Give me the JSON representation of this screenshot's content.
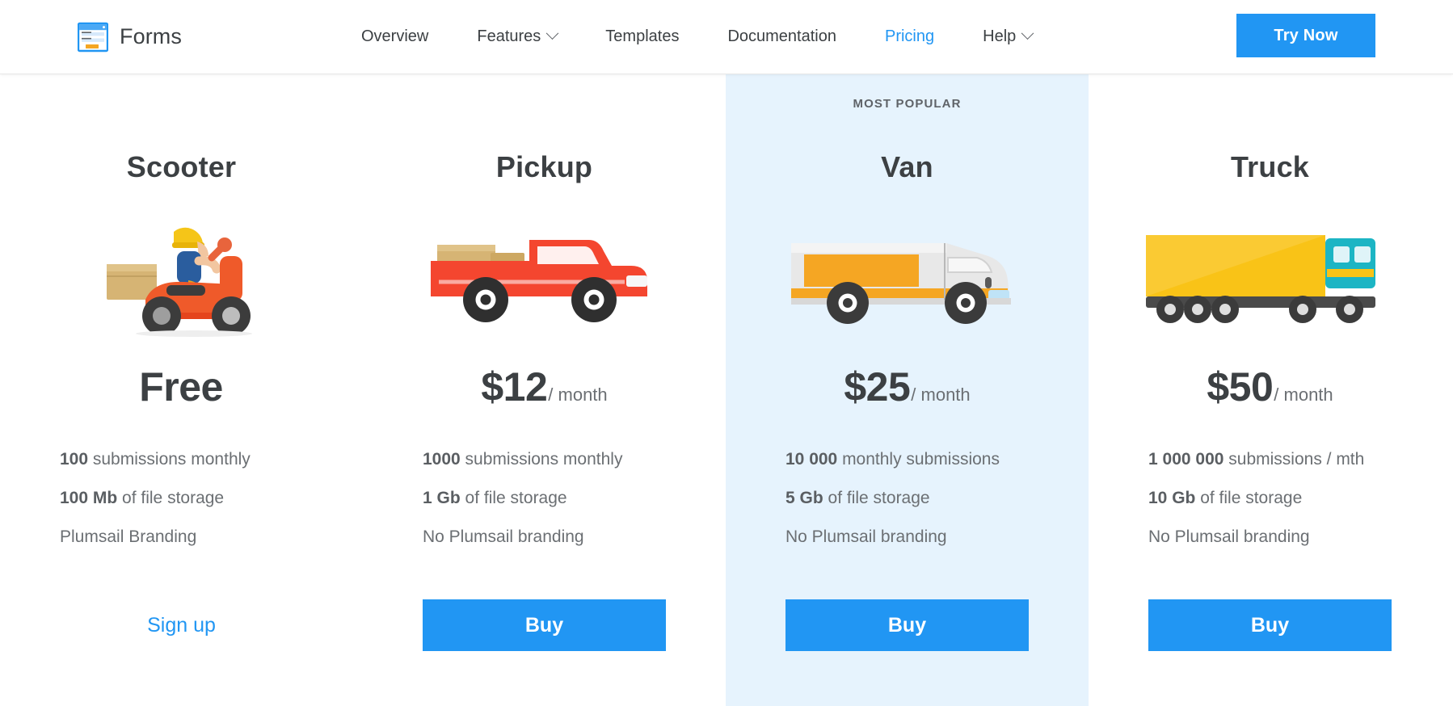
{
  "header": {
    "brand": {
      "icon": "forms-logo-icon",
      "name": "Forms"
    },
    "nav": [
      {
        "label": "Overview",
        "has_dropdown": false,
        "active": false
      },
      {
        "label": "Features",
        "has_dropdown": true,
        "active": false
      },
      {
        "label": "Templates",
        "has_dropdown": false,
        "active": false
      },
      {
        "label": "Documentation",
        "has_dropdown": false,
        "active": false
      },
      {
        "label": "Pricing",
        "has_dropdown": false,
        "active": true
      },
      {
        "label": "Help",
        "has_dropdown": true,
        "active": false
      }
    ],
    "cta": {
      "label": "Try Now"
    }
  },
  "colors": {
    "accent": "#2196f3",
    "featured_bg": "#e6f3fd",
    "text": "#3c4043",
    "muted": "#6b6f73"
  },
  "pricing": {
    "plans": [
      {
        "id": "scooter",
        "badge": "",
        "title": "Scooter",
        "art": "scooter-illustration",
        "price_main": "Free",
        "price_per": "",
        "featured": false,
        "features": [
          {
            "strong": "100",
            "rest": " submissions monthly"
          },
          {
            "strong": "100 Mb",
            "rest": " of file storage"
          },
          {
            "strong": "",
            "rest": "Plumsail Branding"
          }
        ],
        "cta": {
          "type": "link",
          "label": "Sign up"
        }
      },
      {
        "id": "pickup",
        "badge": "",
        "title": "Pickup",
        "art": "pickup-truck-illustration",
        "price_main": "$12",
        "price_per": "/ month",
        "featured": false,
        "features": [
          {
            "strong": "1000",
            "rest": " submissions monthly"
          },
          {
            "strong": "1 Gb",
            "rest": " of file storage"
          },
          {
            "strong": "",
            "rest": "No Plumsail branding"
          }
        ],
        "cta": {
          "type": "button",
          "label": "Buy"
        }
      },
      {
        "id": "van",
        "badge": "MOST POPULAR",
        "title": "Van",
        "art": "van-illustration",
        "price_main": "$25",
        "price_per": "/ month",
        "featured": true,
        "features": [
          {
            "strong": "10 000",
            "rest": " monthly submissions"
          },
          {
            "strong": "5 Gb",
            "rest": " of file storage"
          },
          {
            "strong": "",
            "rest": "No Plumsail branding"
          }
        ],
        "cta": {
          "type": "button",
          "label": "Buy"
        }
      },
      {
        "id": "truck",
        "badge": "",
        "title": "Truck",
        "art": "semi-truck-illustration",
        "price_main": "$50",
        "price_per": "/ month",
        "featured": false,
        "features": [
          {
            "strong": "1 000 000",
            "rest": " submissions / mth"
          },
          {
            "strong": "10 Gb",
            "rest": " of file storage"
          },
          {
            "strong": "",
            "rest": "No Plumsail branding"
          }
        ],
        "cta": {
          "type": "button",
          "label": "Buy"
        }
      }
    ]
  }
}
